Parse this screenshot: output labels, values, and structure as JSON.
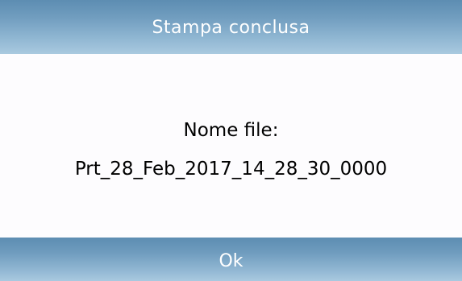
{
  "dialog": {
    "title": "Stampa conclusa",
    "file_label": "Nome file:",
    "file_name": "Prt_28_Feb_2017_14_28_30_0000",
    "ok_label": "Ok"
  },
  "colors": {
    "header_top": "#5d8db2",
    "header_bottom": "#a9c9df",
    "background": "#fdfcfe",
    "text": "#000000",
    "button_text": "#ffffff"
  }
}
